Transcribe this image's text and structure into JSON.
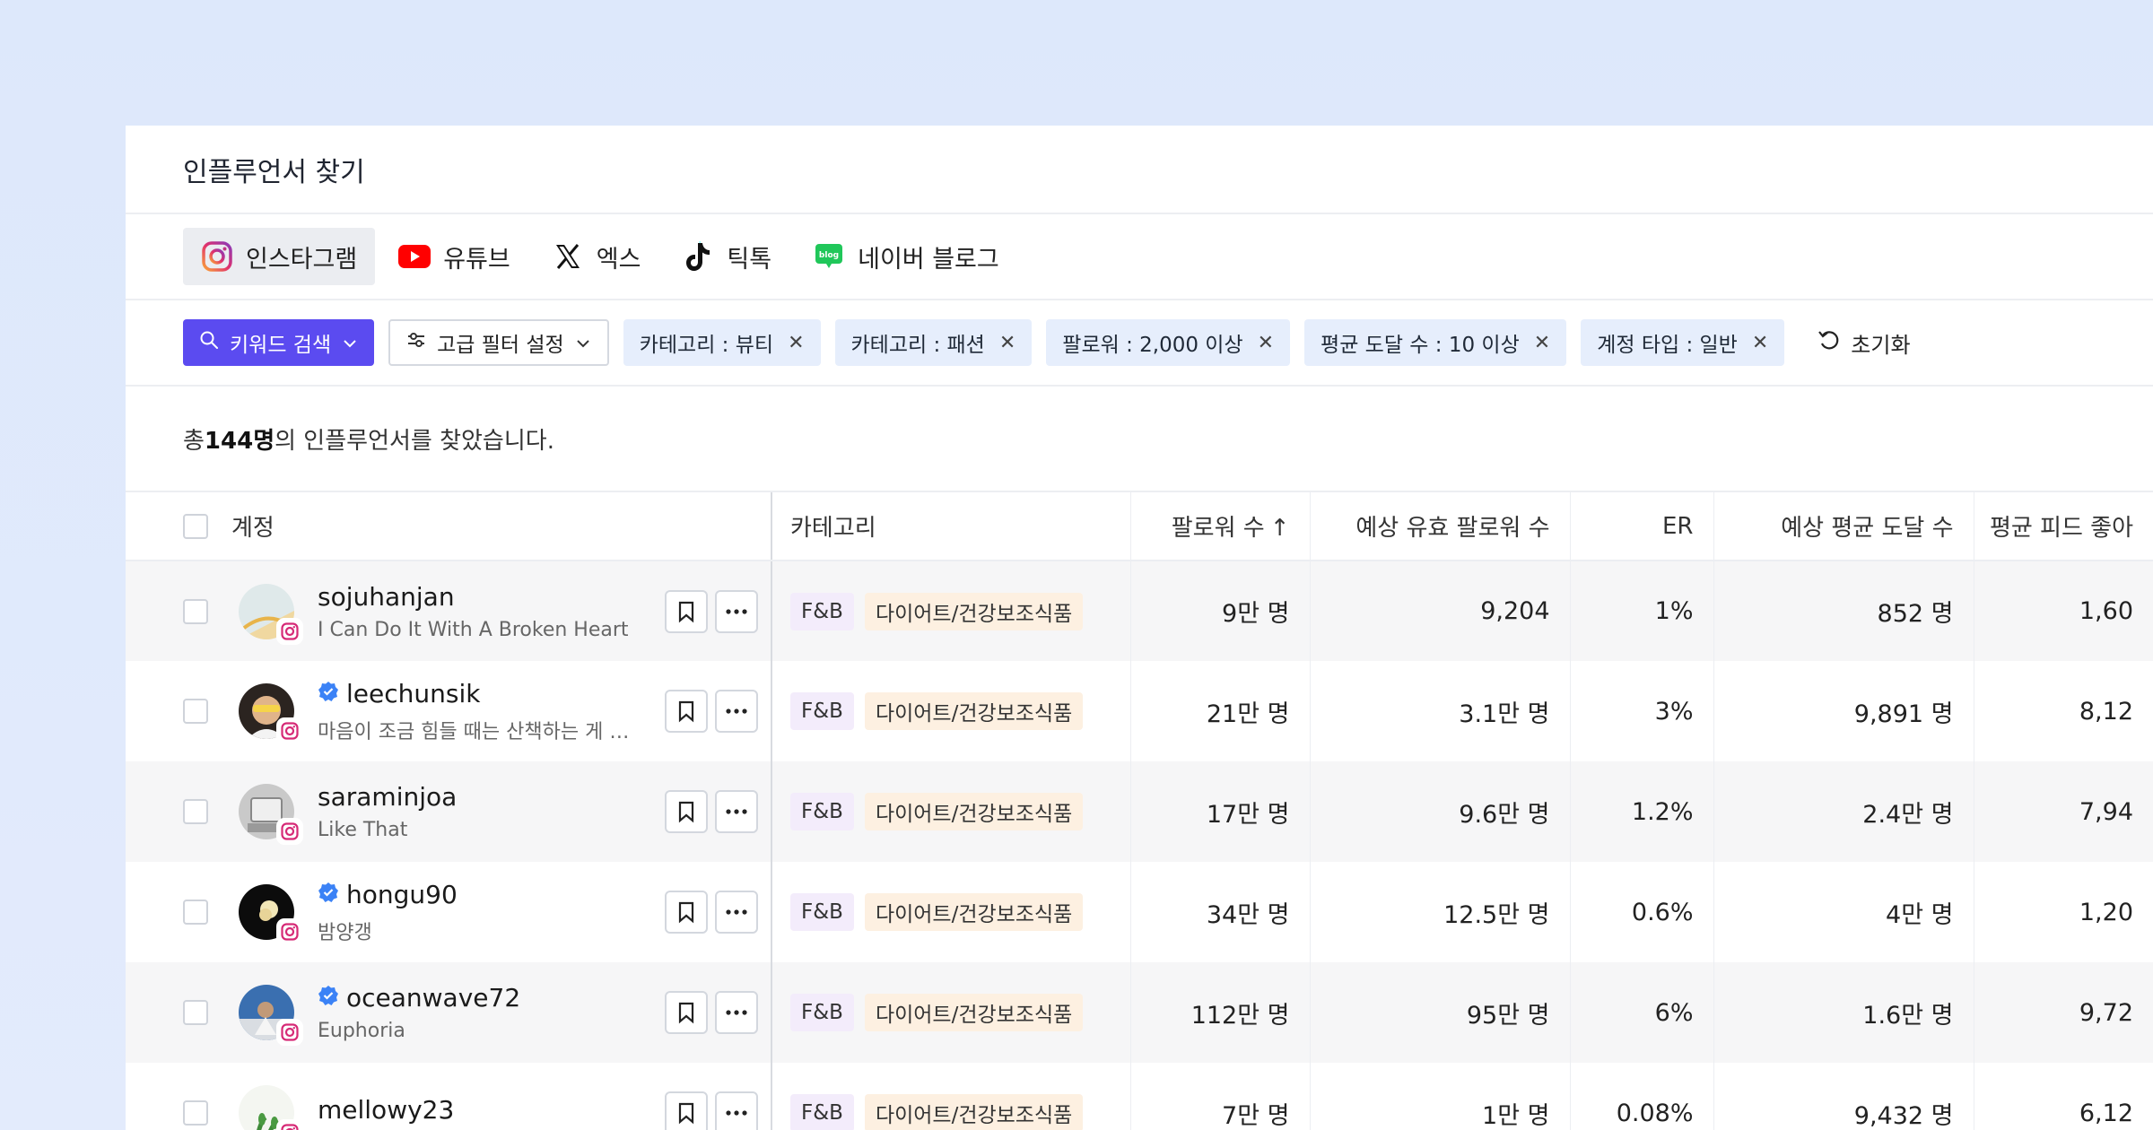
{
  "page": {
    "title": "인플루언서 찾기"
  },
  "tabs": [
    {
      "label": "인스타그램",
      "icon": "instagram-icon",
      "active": true
    },
    {
      "label": "유튜브",
      "icon": "youtube-icon",
      "active": false
    },
    {
      "label": "엑스",
      "icon": "x-icon",
      "active": false
    },
    {
      "label": "틱톡",
      "icon": "tiktok-icon",
      "active": false
    },
    {
      "label": "네이버 블로그",
      "icon": "naver-blog-icon",
      "active": false
    }
  ],
  "filters": {
    "keyword_search": "키워드 검색",
    "advanced": "고급 필터 설정",
    "active": [
      "카테고리 : 뷰티",
      "카테고리 : 패션",
      "팔로워 : 2,000 이상",
      "평균 도달 수 : 10 이상",
      "계정 타입 : 일반"
    ],
    "reset": "초기화"
  },
  "summary": {
    "prefix": "총 ",
    "count": "144명",
    "suffix": "의 인플루언서를 찾았습니다."
  },
  "table": {
    "columns": {
      "account": "계정",
      "category": "카테고리",
      "followers": "팔로워 수",
      "valid_followers": "예상 유효 팔로워 수",
      "er": "ER",
      "avg_reach": "예상 평균 도달 수",
      "avg_feed_likes": "평균 피드 좋아"
    },
    "rows": [
      {
        "username": "sojuhanjan",
        "verified": false,
        "bio": "I Can Do It With A Broken Heart",
        "cat1": "F&B",
        "cat2": "다이어트/건강보조식품",
        "followers": "9만 명",
        "valid": "9,204",
        "er": "1%",
        "reach": "852 명",
        "likes": "1,60"
      },
      {
        "username": "leechunsik",
        "verified": true,
        "bio": "마음이 조금 힘들 때는 산책하는 게 최고...",
        "cat1": "F&B",
        "cat2": "다이어트/건강보조식품",
        "followers": "21만 명",
        "valid": "3.1만 명",
        "er": "3%",
        "reach": "9,891 명",
        "likes": "8,12"
      },
      {
        "username": "saraminjoa",
        "verified": false,
        "bio": "Like That",
        "cat1": "F&B",
        "cat2": "다이어트/건강보조식품",
        "followers": "17만 명",
        "valid": "9.6만 명",
        "er": "1.2%",
        "reach": "2.4만 명",
        "likes": "7,94"
      },
      {
        "username": "hongu90",
        "verified": true,
        "bio": "밤양갱",
        "cat1": "F&B",
        "cat2": "다이어트/건강보조식품",
        "followers": "34만 명",
        "valid": "12.5만 명",
        "er": "0.6%",
        "reach": "4만 명",
        "likes": "1,20"
      },
      {
        "username": "oceanwave72",
        "verified": true,
        "bio": "Euphoria",
        "cat1": "F&B",
        "cat2": "다이어트/건강보조식품",
        "followers": "112만 명",
        "valid": "95만 명",
        "er": "6%",
        "reach": "1.6만 명",
        "likes": "9,72"
      },
      {
        "username": "mellowy23",
        "verified": false,
        "bio": "",
        "cat1": "F&B",
        "cat2": "다이어트/건강보조식품",
        "followers": "7만 명",
        "valid": "1만 명",
        "er": "0.08%",
        "reach": "9,432 명",
        "likes": "6,12"
      }
    ]
  },
  "colors": {
    "primary": "#5b4bf0",
    "tag_bg": "#e6eefc",
    "fb_pill": "#f3ecfb",
    "diet_pill": "#fdf0e1",
    "verified": "#3b82f6"
  }
}
